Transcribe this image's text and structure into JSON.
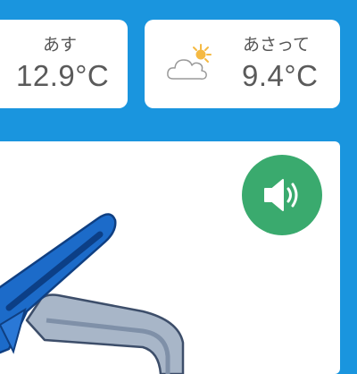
{
  "forecast": [
    {
      "day": "あす",
      "temp": "12.9°C",
      "icon": "none-visible"
    },
    {
      "day": "あさって",
      "temp": "9.4°C",
      "icon": "sun-behind-cloud-icon"
    }
  ],
  "speaker": {
    "icon": "speaker-volume-icon",
    "color": "#3aaa6e"
  },
  "colors": {
    "background": "#1a95de",
    "card": "#ffffff",
    "text": "#5a5a5a"
  },
  "illustration": {
    "subject": "blue-clothespin-illustration"
  }
}
